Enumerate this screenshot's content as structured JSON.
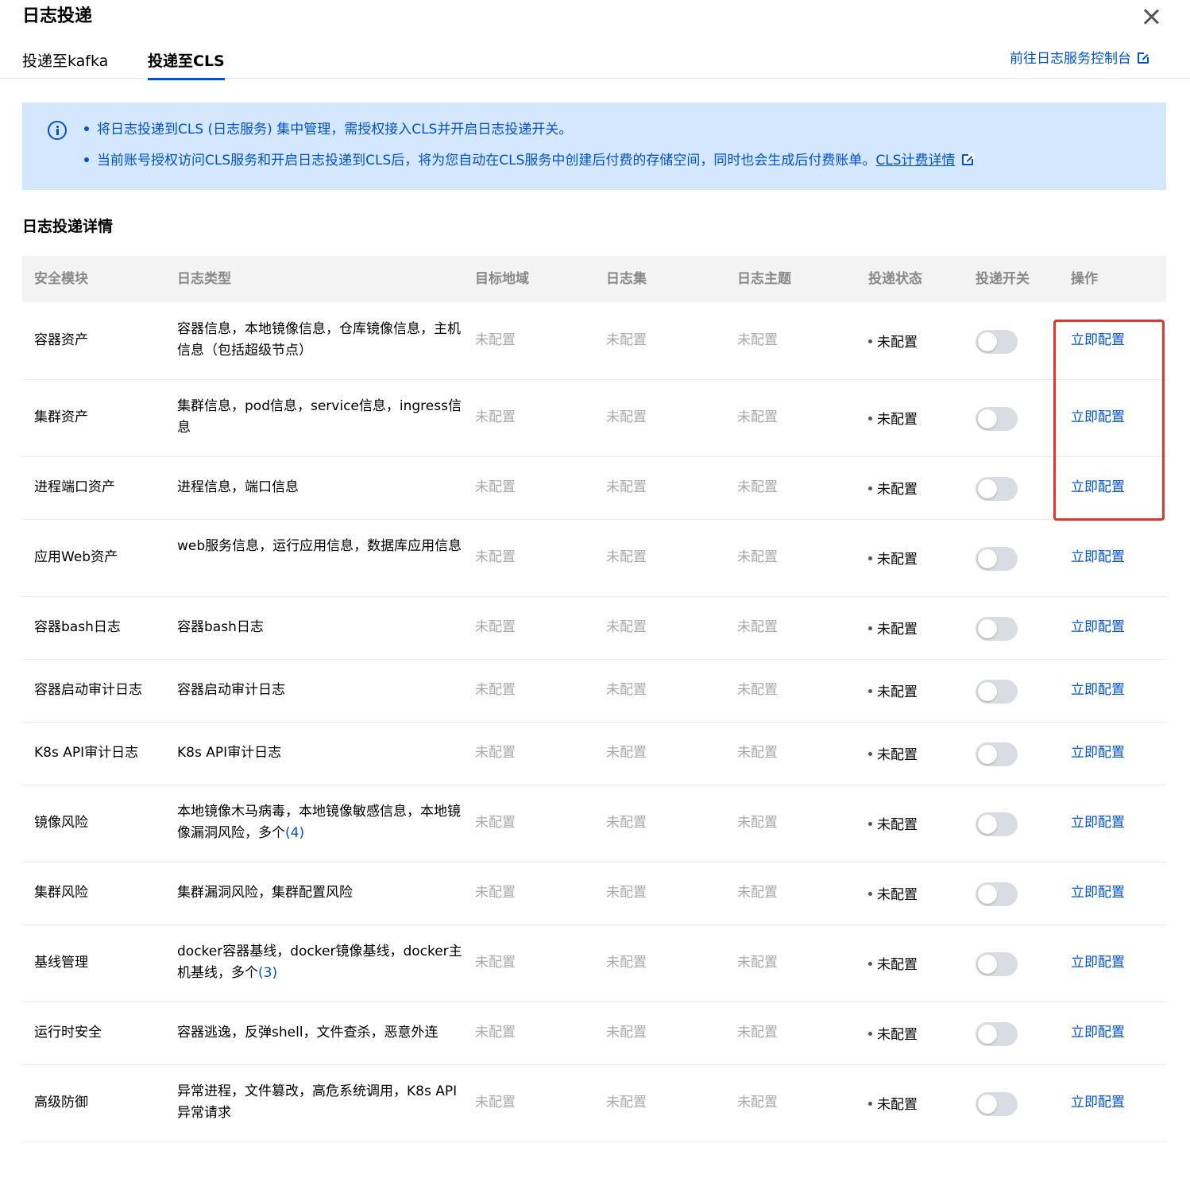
{
  "dialog": {
    "title": "日志投递",
    "close_icon": "close-icon"
  },
  "tabs": [
    {
      "label": "投递至kafka",
      "active": false
    },
    {
      "label": "投递至CLS",
      "active": true
    }
  ],
  "console_link": "前往日志服务控制台",
  "notice": {
    "line1": "将日志投递到CLS (日志服务) 集中管理，需授权接入CLS并开启日志投递开关。",
    "line2": "当前账号授权访问CLS服务和开启日志投递到CLS后，将为您自动在CLS服务中创建后付费的存储空间，同时也会生成后付费账单。",
    "billing_link": "CLS计费详情",
    "background": "#d5e7ff",
    "text_color": "#0052d9"
  },
  "section_title": "日志投递详情",
  "table": {
    "headers": {
      "module": "安全模块",
      "type": "日志类型",
      "region": "目标地域",
      "logset": "日志集",
      "topic": "日志主题",
      "status": "投递状态",
      "switch": "投递开关",
      "action": "操作"
    },
    "rows": [
      {
        "module": "容器资产",
        "type": "容器信息，本地镜像信息，仓库镜像信息，主机信息（包括超级节点）",
        "more": "",
        "region": "未配置",
        "logset": "未配置",
        "topic": "未配置",
        "status": "未配置",
        "switch_on": false,
        "action": "立即配置"
      },
      {
        "module": "集群资产",
        "type": "集群信息，pod信息，service信息，ingress信息",
        "more": "",
        "region": "未配置",
        "logset": "未配置",
        "topic": "未配置",
        "status": "未配置",
        "switch_on": false,
        "action": "立即配置"
      },
      {
        "module": "进程端口资产",
        "type": "进程信息，端口信息",
        "more": "",
        "region": "未配置",
        "logset": "未配置",
        "topic": "未配置",
        "status": "未配置",
        "switch_on": false,
        "action": "立即配置"
      },
      {
        "module": "应用Web资产",
        "type": "web服务信息，运行应用信息，数据库应用信息",
        "more": "",
        "region": "未配置",
        "logset": "未配置",
        "topic": "未配置",
        "status": "未配置",
        "switch_on": false,
        "action": "立即配置"
      },
      {
        "module": "容器bash日志",
        "type": "容器bash日志",
        "more": "",
        "region": "未配置",
        "logset": "未配置",
        "topic": "未配置",
        "status": "未配置",
        "switch_on": false,
        "action": "立即配置"
      },
      {
        "module": "容器启动审计日志",
        "type": "容器启动审计日志",
        "more": "",
        "region": "未配置",
        "logset": "未配置",
        "topic": "未配置",
        "status": "未配置",
        "switch_on": false,
        "action": "立即配置"
      },
      {
        "module": "K8s API审计日志",
        "type": "K8s API审计日志",
        "more": "",
        "region": "未配置",
        "logset": "未配置",
        "topic": "未配置",
        "status": "未配置",
        "switch_on": false,
        "action": "立即配置"
      },
      {
        "module": "镜像风险",
        "type": "本地镜像木马病毒，本地镜像敏感信息，本地镜像漏洞风险，多个",
        "more": "(4)",
        "region": "未配置",
        "logset": "未配置",
        "topic": "未配置",
        "status": "未配置",
        "switch_on": false,
        "action": "立即配置"
      },
      {
        "module": "集群风险",
        "type": "集群漏洞风险，集群配置风险",
        "more": "",
        "region": "未配置",
        "logset": "未配置",
        "topic": "未配置",
        "status": "未配置",
        "switch_on": false,
        "action": "立即配置"
      },
      {
        "module": "基线管理",
        "type": "docker容器基线，docker镜像基线，docker主机基线，多个",
        "more": "(3)",
        "region": "未配置",
        "logset": "未配置",
        "topic": "未配置",
        "status": "未配置",
        "switch_on": false,
        "action": "立即配置"
      },
      {
        "module": "运行时安全",
        "type": "容器逃逸，反弹shell，文件查杀，恶意外连",
        "more": "",
        "region": "未配置",
        "logset": "未配置",
        "topic": "未配置",
        "status": "未配置",
        "switch_on": false,
        "action": "立即配置"
      },
      {
        "module": "高级防御",
        "type": "异常进程，文件篡改，高危系统调用，K8s API异常请求",
        "more": "",
        "region": "未配置",
        "logset": "未配置",
        "topic": "未配置",
        "status": "未配置",
        "switch_on": false,
        "action": "立即配置"
      }
    ]
  },
  "colors": {
    "accent": "#0052d9",
    "highlight_border": "#e0362e",
    "muted_text": "#a8a8a8",
    "header_bg": "#f3f3f3"
  }
}
